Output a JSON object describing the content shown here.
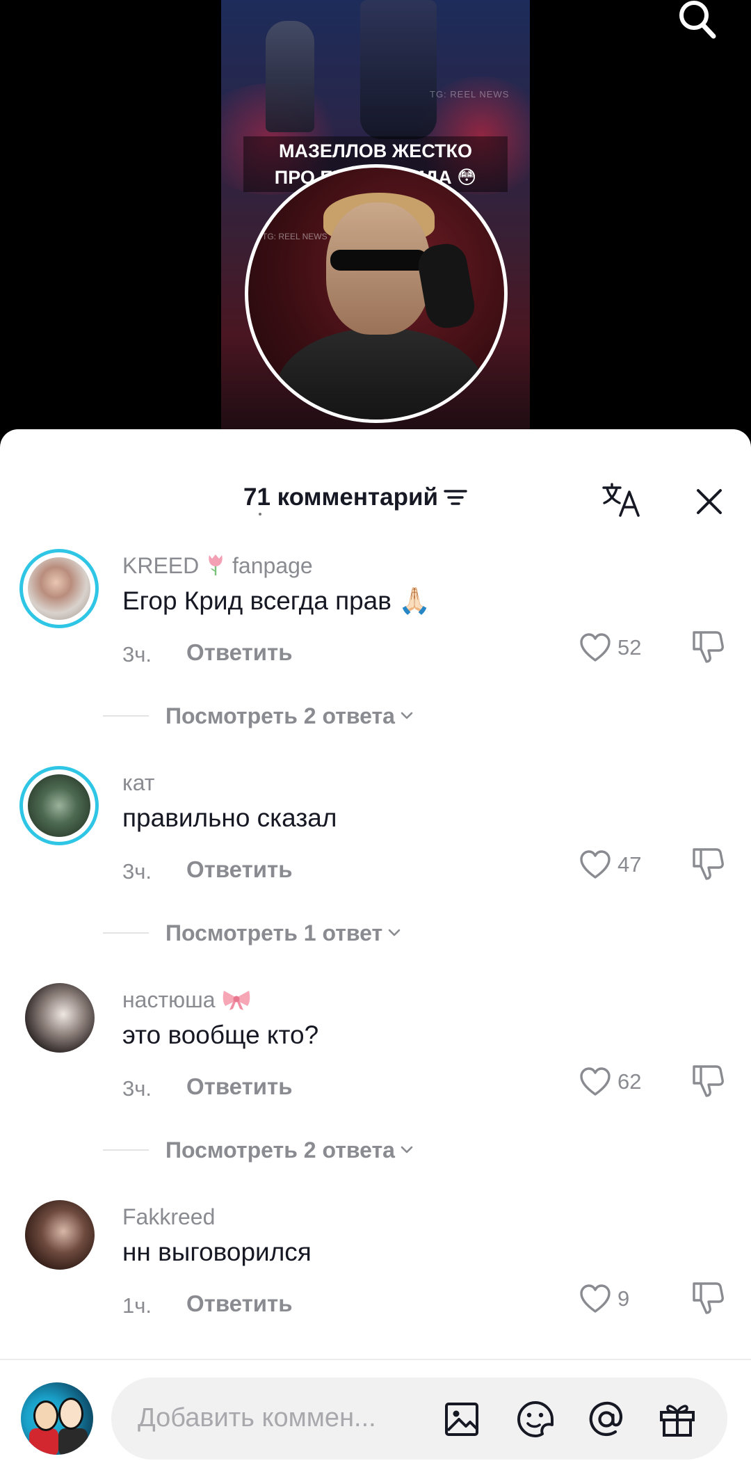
{
  "video": {
    "caption_line1": "МАЗЕЛЛОВ ЖЕСТКО",
    "caption_line2": "ПРО ЕГОРА КРИДА 😳",
    "watermark": "TG: REEL NEWS",
    "watermark2": "TG: REEL NEWS"
  },
  "comments_sheet": {
    "title": "71 комментарий"
  },
  "comments": [
    {
      "user_prefix": "KREED",
      "user_suffix": "fanpage",
      "text": "Егор Крид всегда прав 🙏🏻",
      "time": "3ч.",
      "reply": "Ответить",
      "likes": "52",
      "view_replies": "Посмотреть 2 ответа"
    },
    {
      "user": "кат",
      "text": "правильно сказал",
      "time": "3ч.",
      "reply": "Ответить",
      "likes": "47",
      "view_replies": "Посмотреть 1 ответ"
    },
    {
      "user": "настюша",
      "text": "это вообще кто?",
      "time": "3ч.",
      "reply": "Ответить",
      "likes": "62",
      "view_replies": "Посмотреть 2 ответа"
    },
    {
      "user": "Fakkreed",
      "text": "нн выговорился",
      "time": "1ч.",
      "reply": "Ответить",
      "likes": "9"
    }
  ],
  "input": {
    "placeholder": "Добавить коммен..."
  },
  "colors": {
    "story_ring": "#2fc6e6",
    "text_primary": "#161823",
    "text_secondary": "#8a8b91"
  }
}
